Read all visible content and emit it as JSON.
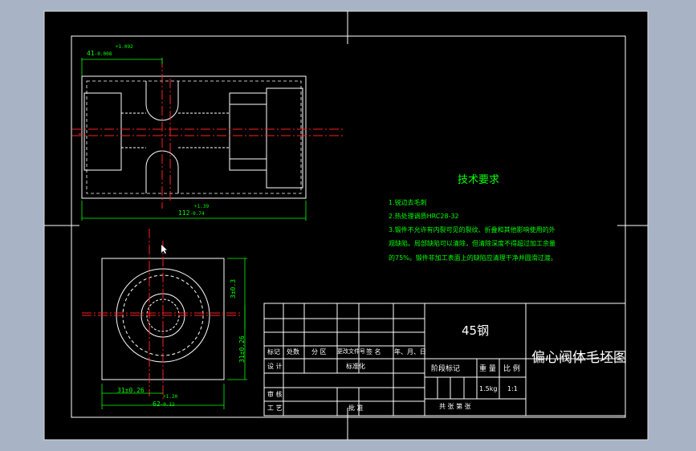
{
  "drawing": {
    "tech_requirements": {
      "title": "技术要求",
      "lines": [
        "1.锐边去毛刺",
        "2.热处理调质HRC28-32",
        "3.锻件不允许有内裂可见的裂纹、折叠和其他影响使用的外",
        "观缺陷。局部缺陷可以清除，但清除深度不得超过加工余量",
        "的75%。锻件非加工表面上的缺陷应清理干净并圆滑过渡。"
      ]
    },
    "dimensions": {
      "top_width": "41",
      "top_width_tol_upper": "+1.092",
      "top_width_tol_lower": "-0.008",
      "overall_length": "112",
      "overall_length_tol_upper": "+1.39",
      "overall_length_tol_lower": "-0.74",
      "side_small": "3±0.3",
      "side_height": "31±0.26",
      "bottom_half": "31±0.26",
      "bottom_width": "62",
      "bottom_width_tol_upper": "+1.20",
      "bottom_width_tol_lower": "-0.12"
    },
    "title_block": {
      "material": "45钢",
      "drawing_name": "偏心阀体毛坯图",
      "rev_headers": [
        "标记",
        "处数",
        "分 区",
        "更改文件号",
        "签 名",
        "年、月、日"
      ],
      "design_label": "设 计",
      "standardize_label": "标准化",
      "review_label": "审 核",
      "process_label": "工 艺",
      "approve_label": "批 准",
      "stage_label": "阶段标记",
      "weight_label": "重 量",
      "scale_label": "比 例",
      "weight_value": "1.5kg",
      "scale_value": "1:1",
      "sheets_label": "共  张  第  张"
    },
    "colors": {
      "sheet": "#000000",
      "outline": "#ffffff",
      "center_line": "#ff2020",
      "dimension": "#00ff00",
      "background": "#a8b4c6"
    }
  }
}
